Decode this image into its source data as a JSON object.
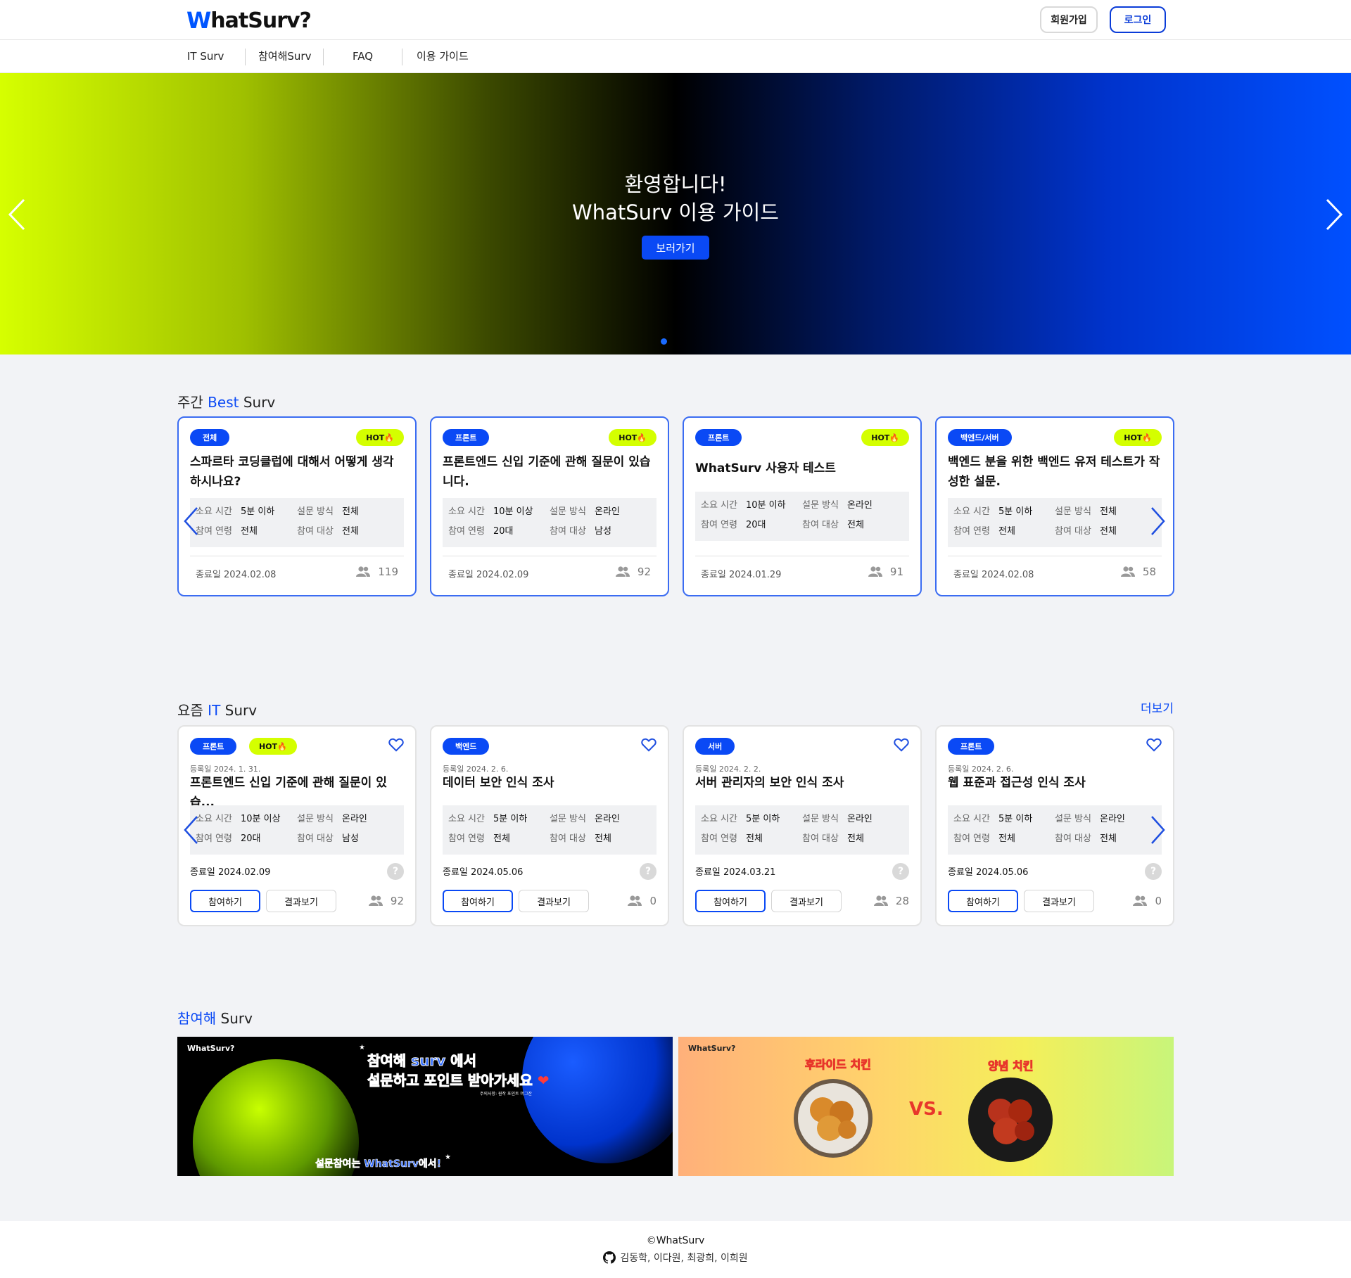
{
  "header": {
    "logo_w": "W",
    "logo_rest": "hatSurv?",
    "signup": "회원가입",
    "login": "로그인"
  },
  "nav": {
    "items": [
      "IT Surv",
      "참여해Surv",
      "FAQ",
      "이용 가이드"
    ]
  },
  "hero": {
    "line1": "환영합니다!",
    "line2": "WhatSurv 이용 가이드",
    "button": "보러가기"
  },
  "best": {
    "title_pre": "주간 ",
    "title_acc": "Best",
    "title_post": " Surv",
    "cards": [
      {
        "tag": "전체",
        "hot": "HOT🔥",
        "title": "스파르타 코딩클럽에 대해서 어떻게 생각하시나요?",
        "time_k": "소요 시간",
        "time_v": "5분 이하",
        "method_k": "설문 방식",
        "method_v": "전체",
        "age_k": "참여 연령",
        "age_v": "전체",
        "target_k": "참여 대상",
        "target_v": "전체",
        "end": "종료일 2024.02.08",
        "count": "119"
      },
      {
        "tag": "프론트",
        "hot": "HOT🔥",
        "title": "프론트엔드 신입 기준에 관해 질문이 있습니다.",
        "time_k": "소요 시간",
        "time_v": "10분 이상",
        "method_k": "설문 방식",
        "method_v": "온라인",
        "age_k": "참여 연령",
        "age_v": "20대",
        "target_k": "참여 대상",
        "target_v": "남성",
        "end": "종료일 2024.02.09",
        "count": "92"
      },
      {
        "tag": "프론트",
        "hot": "HOT🔥",
        "title": "WhatSurv 사용자 테스트",
        "time_k": "소요 시간",
        "time_v": "10분 이하",
        "method_k": "설문 방식",
        "method_v": "온라인",
        "age_k": "참여 연령",
        "age_v": "20대",
        "target_k": "참여 대상",
        "target_v": "전체",
        "end": "종료일 2024.01.29",
        "count": "91"
      },
      {
        "tag": "백엔드/서버",
        "hot": "HOT🔥",
        "title": "백엔드 분을 위한 백엔드 유저 테스트가 작성한 설문.",
        "time_k": "소요 시간",
        "time_v": "5분 이하",
        "method_k": "설문 방식",
        "method_v": "전체",
        "age_k": "참여 연령",
        "age_v": "전체",
        "target_k": "참여 대상",
        "target_v": "전체",
        "end": "종료일 2024.02.08",
        "count": "58"
      }
    ]
  },
  "it": {
    "title_pre": "요즘 ",
    "title_acc": "IT",
    "title_post": " Surv",
    "more": "더보기",
    "join": "참여하기",
    "result": "결과보기",
    "help": "?",
    "cards": [
      {
        "tag": "프론트",
        "hot": "HOT🔥",
        "reg": "등록일 2024. 1. 31.",
        "title": "프론트엔드 신입 기준에 관해 질문이 있습...",
        "time_v": "10분 이상",
        "method_v": "온라인",
        "age_v": "20대",
        "target_v": "남성",
        "end": "종료일 2024.02.09",
        "count": "92"
      },
      {
        "tag": "백엔드",
        "hot": "",
        "reg": "등록일 2024. 2. 6.",
        "title": "데이터 보안 인식 조사",
        "time_v": "5분 이하",
        "method_v": "온라인",
        "age_v": "전체",
        "target_v": "전체",
        "end": "종료일 2024.05.06",
        "count": "0"
      },
      {
        "tag": "서버",
        "hot": "",
        "reg": "등록일 2024. 2. 2.",
        "title": "서버 관리자의 보안 인식 조사",
        "time_v": "5분 이하",
        "method_v": "온라인",
        "age_v": "전체",
        "target_v": "전체",
        "end": "종료일 2024.03.21",
        "count": "28"
      },
      {
        "tag": "프론트",
        "hot": "",
        "reg": "등록일 2024. 2. 6.",
        "title": "웹 표준과 접근성 인식 조사",
        "time_v": "5분 이하",
        "method_v": "온라인",
        "age_v": "전체",
        "target_v": "전체",
        "end": "종료일 2024.05.06",
        "count": "0"
      }
    ],
    "labels": {
      "time": "소요 시간",
      "method": "설문 방식",
      "age": "참여 연령",
      "target": "참여 대상"
    }
  },
  "join_surv": {
    "title_acc": "참여해",
    "title_post": " Surv",
    "banner1": {
      "logo": "WhatSurv?",
      "line1": "참여해 surv 에서",
      "line2": "설문하고 포인트 받아가세요",
      "small": "주의사항: 원작 포인트 머그잔",
      "bottom": "설문참여는 WhatSurv에서!"
    },
    "banner2": {
      "logo": "WhatSurv?",
      "left": "후라이드 치킨",
      "vs": "VS.",
      "right": "양념 치킨"
    }
  },
  "footer": {
    "copy": "©WhatSurv",
    "names": "김동학, 이다원, 최광희, 이희원"
  },
  "colors": {
    "accent": "#0a49f5",
    "hot": "#d4ff00"
  }
}
